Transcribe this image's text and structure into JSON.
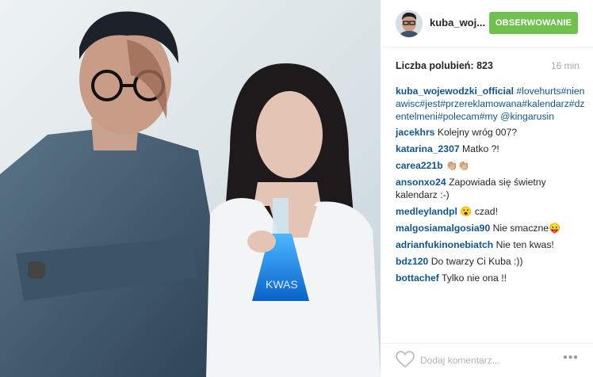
{
  "post": {
    "photo_label": "KWAS"
  },
  "header": {
    "username": "kuba_woj...",
    "follow_label": "OBSERWOWANIE"
  },
  "meta": {
    "likes": "Liczba polubień: 823",
    "time": "16 min"
  },
  "caption": {
    "user": "kuba_wojewodzki_official",
    "text": "#lovehurts#nienawisc#jest#przereklamowana#kalendarz#dzentelmeni#polecam#my @kingarusin"
  },
  "comments": [
    {
      "user": "jacekhrs",
      "text": "Kolejny wróg 007?"
    },
    {
      "user": "katarina_2307",
      "text": "Matko ?!"
    },
    {
      "user": "carea221b",
      "text": "👏🏼👏🏼"
    },
    {
      "user": "ansonxo24",
      "text": "Zapowiada się świetny kalendarz :-)"
    },
    {
      "user": "medleylandpl",
      "text": "😮 czad!"
    },
    {
      "user": "malgosiamalgosia90",
      "text": "Nie smaczne😛"
    },
    {
      "user": "adrianfukinonebiatch",
      "text": "Nie ten kwas!"
    },
    {
      "user": "bdz120",
      "text": "Do twarzy Ci Kuba :))"
    },
    {
      "user": "bottachef",
      "text": "Tylko nie ona !!"
    }
  ],
  "footer": {
    "comment_placeholder": "Dodaj komentarz...",
    "more_label": "•••"
  },
  "colors": {
    "follow": "#70c050",
    "link": "#125688",
    "muted": "#a5a7aa"
  },
  "icons": {
    "like": "heart-icon",
    "more": "more-options-icon"
  }
}
